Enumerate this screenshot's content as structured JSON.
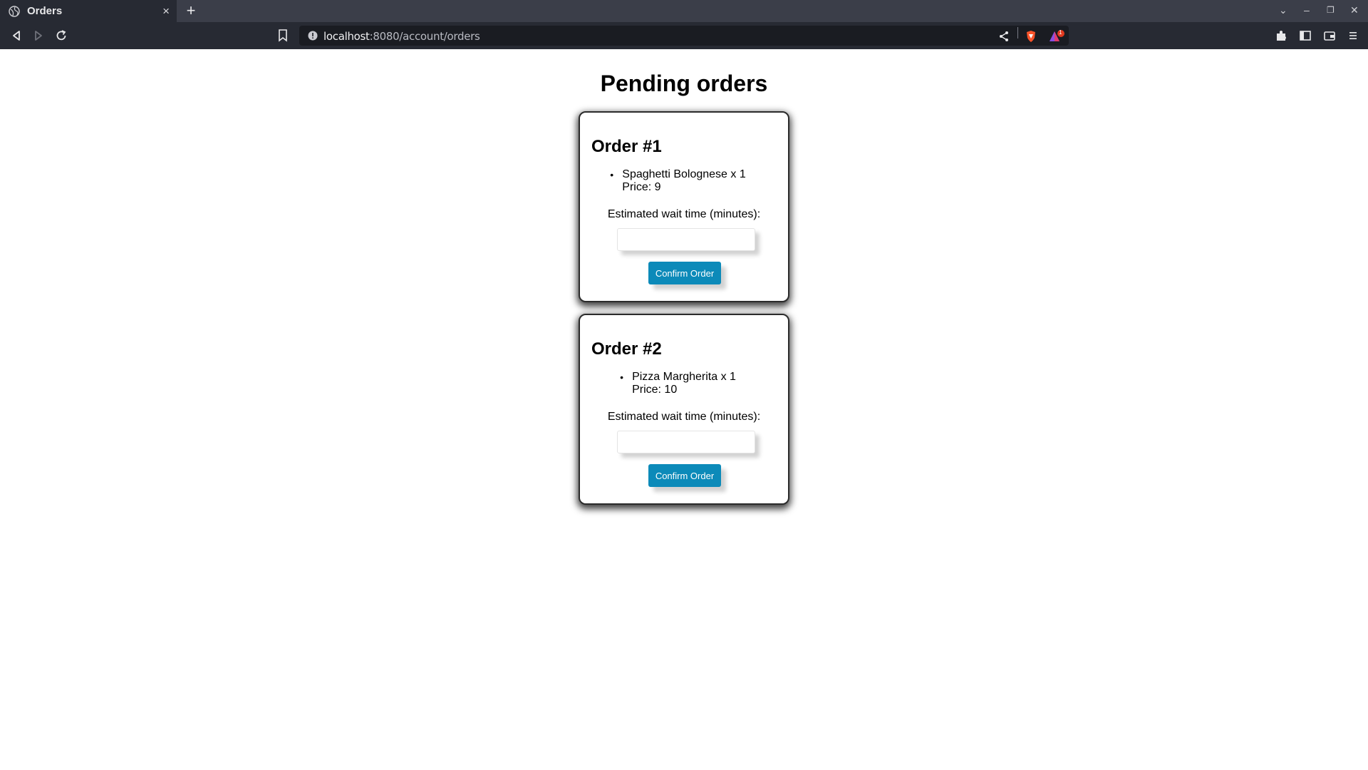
{
  "browser": {
    "tab_title": "Orders",
    "tab_close": "×",
    "new_tab": "+",
    "url_host": "localhost",
    "url_rest": ":8080/account/orders",
    "icons": {
      "back": "back-icon",
      "forward": "forward-icon",
      "reload": "reload-icon",
      "bookmark": "bookmark-icon",
      "site_info": "site-info-icon",
      "share": "share-icon",
      "brave_shield": "brave-shield-icon",
      "rewards": "rewards-icon",
      "extensions": "extensions-icon",
      "sidebar": "sidebar-icon",
      "wallet": "wallet-icon",
      "menu": "menu-icon"
    },
    "rewards_badge": "1",
    "window_controls": {
      "tab_list": "⌄",
      "minimize": "–",
      "restore": "❐",
      "close": "✕"
    }
  },
  "page": {
    "title": "Pending orders",
    "orders": [
      {
        "heading": "Order #1",
        "item_name_line": "Spaghetti Bolognese x 1",
        "item_price_line": "Price: 9",
        "wait_label": "Estimated wait time (minutes):",
        "wait_value": "",
        "confirm_label": "Confirm Order"
      },
      {
        "heading": "Order #2",
        "item_name_line": "Pizza Margherita x 1",
        "item_price_line": "Price: 10",
        "wait_label": "Estimated wait time (minutes):",
        "wait_value": "",
        "confirm_label": "Confirm Order"
      }
    ]
  },
  "colors": {
    "tabbar_bg": "#3b3e49",
    "toolbar_bg": "#272a33",
    "button_bg": "#0c8ab9",
    "button_text": "#ffffff",
    "brave_orange": "#fb542b"
  }
}
